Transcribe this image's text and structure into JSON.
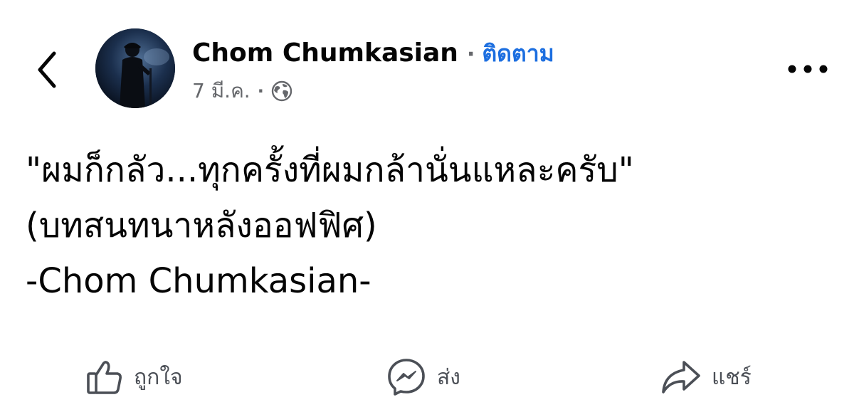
{
  "header": {
    "author_name": "Chom Chumkasian",
    "separator": "·",
    "follow_label": "ติดตาม",
    "date": "7 มี.ค.",
    "meta_separator": "·",
    "privacy_icon": "globe-icon",
    "back_icon": "chevron-left-icon",
    "more_icon": "more-horizontal-icon"
  },
  "post": {
    "lines": [
      "\"ผมก็กลัว...ทุกครั้งที่ผมกล้านั่นแหละครับ\"",
      "(บทสนทนาหลังออฟฟิศ)",
      "-Chom Chumkasian-"
    ]
  },
  "actions": {
    "like_label": "ถูกใจ",
    "send_label": "ส่ง",
    "share_label": "แชร์"
  },
  "colors": {
    "follow_link": "#1d6fe0",
    "secondary_text": "#65676b",
    "action_icon": "#4b4f56"
  }
}
